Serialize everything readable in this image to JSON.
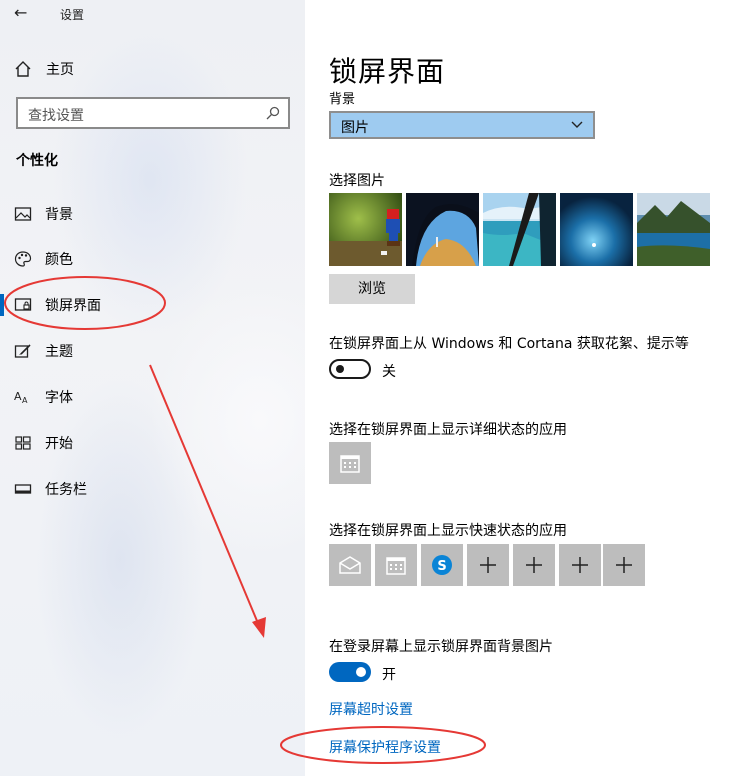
{
  "window": {
    "title": "设置",
    "back_icon": "back-arrow-icon"
  },
  "sidebar": {
    "home_label": "主页",
    "search_placeholder": "查找设置",
    "section_title": "个性化",
    "items": [
      {
        "label": "背景",
        "icon": "image-icon"
      },
      {
        "label": "颜色",
        "icon": "palette-icon"
      },
      {
        "label": "锁屏界面",
        "icon": "lockscreen-icon",
        "selected": true
      },
      {
        "label": "主题",
        "icon": "theme-brush-icon"
      },
      {
        "label": "字体",
        "icon": "font-icon"
      },
      {
        "label": "开始",
        "icon": "start-grid-icon"
      },
      {
        "label": "任务栏",
        "icon": "taskbar-icon"
      }
    ]
  },
  "main": {
    "title": "锁屏界面",
    "background_label": "背景",
    "background_value": "图片",
    "choose_picture_label": "选择图片",
    "browse_label": "浏览",
    "fun_facts_label": "在锁屏界面上从 Windows 和 Cortana 获取花絮、提示等",
    "fun_facts_state": "关",
    "detailed_status_label": "选择在锁屏界面上显示详细状态的应用",
    "quick_status_label": "选择在锁屏界面上显示快速状态的应用",
    "quick_apps": [
      "mail-icon",
      "calendar-icon",
      "skype-icon",
      "add-icon",
      "add-icon",
      "add-icon",
      "add-icon"
    ],
    "signin_bg_label": "在登录屏幕上显示锁屏界面背景图片",
    "signin_bg_state": "开",
    "timeout_link": "屏幕超时设置",
    "screensaver_link": "屏幕保护程序设置"
  },
  "colors": {
    "accent": "#0067c0",
    "dropdown_bg": "#9ecbf0",
    "annotation": "#e53935"
  }
}
